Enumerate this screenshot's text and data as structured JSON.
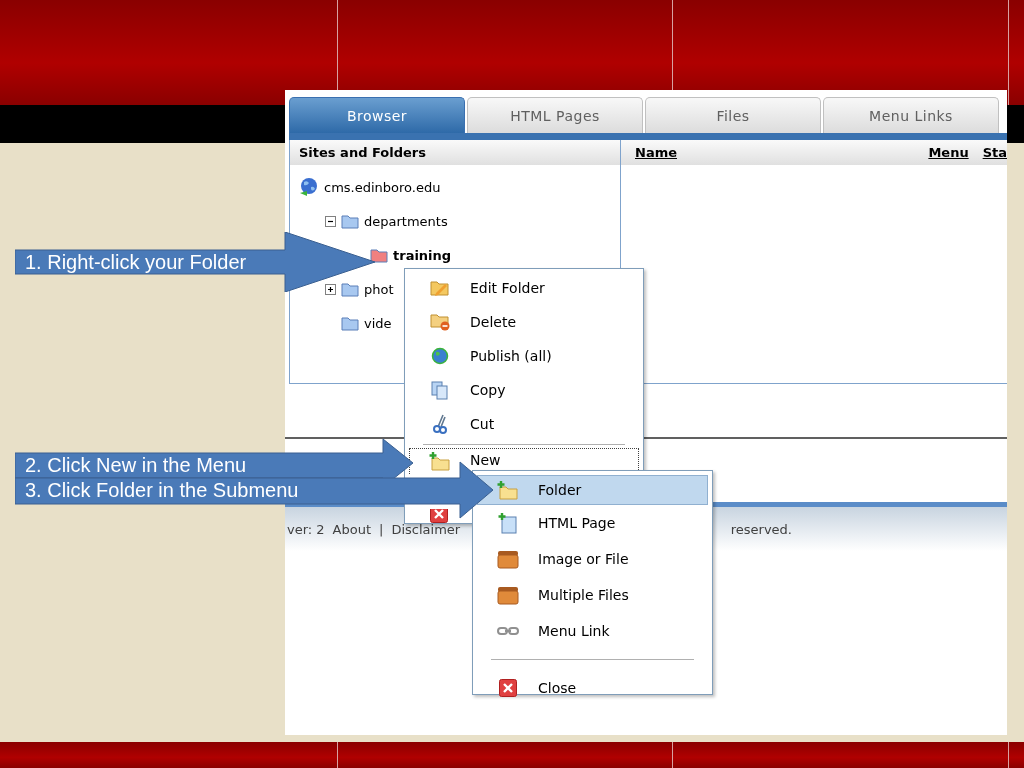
{
  "tabs": [
    {
      "label": "Browser",
      "selected": true
    },
    {
      "label": "HTML Pages",
      "selected": false
    },
    {
      "label": "Files",
      "selected": false
    },
    {
      "label": "Menu Links",
      "selected": false
    }
  ],
  "tree": {
    "header": "Sites and Folders",
    "items": [
      {
        "label": "cms.edinboro.edu",
        "kind": "site",
        "selected": false,
        "children": [
          {
            "label": "departments",
            "kind": "folder",
            "selected": false,
            "expanded": true,
            "children": [
              {
                "label": "training",
                "kind": "folder",
                "selected": true
              }
            ]
          },
          {
            "label": "phot",
            "kind": "folder",
            "selected": false,
            "expanded": false
          },
          {
            "label": "vide",
            "kind": "folder",
            "selected": false
          }
        ]
      }
    ]
  },
  "columns": [
    "Name",
    "Menu",
    "Sta"
  ],
  "footer": [
    "ver: 2",
    "About",
    "|",
    "Disclaimer",
    "reserved."
  ],
  "context_menu": [
    {
      "label": "Edit Folder",
      "kind": "edit",
      "selected": false
    },
    {
      "label": "Delete",
      "kind": "delete",
      "selected": false
    },
    {
      "label": "Publish (all)",
      "kind": "publish",
      "selected": false
    },
    {
      "label": "Copy",
      "kind": "copy",
      "selected": false
    },
    {
      "label": "Cut",
      "kind": "cut",
      "selected": false
    },
    {
      "kind": "separator"
    },
    {
      "label": "New",
      "kind": "new-folder",
      "selected": true
    },
    {
      "kind": "close",
      "selected": false
    }
  ],
  "submenu": [
    {
      "label": "Folder",
      "kind": "new-folder",
      "selected": true
    },
    {
      "label": "HTML Page",
      "kind": "new-page",
      "selected": false
    },
    {
      "label": "Image or File",
      "kind": "box",
      "selected": false
    },
    {
      "label": "Multiple Files",
      "kind": "box",
      "selected": false
    },
    {
      "label": "Menu Link",
      "kind": "link",
      "selected": false
    },
    {
      "kind": "separator"
    },
    {
      "label": "Close",
      "kind": "close",
      "selected": false
    }
  ],
  "callouts": [
    {
      "text": "1. Right-click your Folder"
    },
    {
      "text": "2. Click New in the Menu"
    },
    {
      "text": "3. Click Folder in the Submenu"
    }
  ]
}
